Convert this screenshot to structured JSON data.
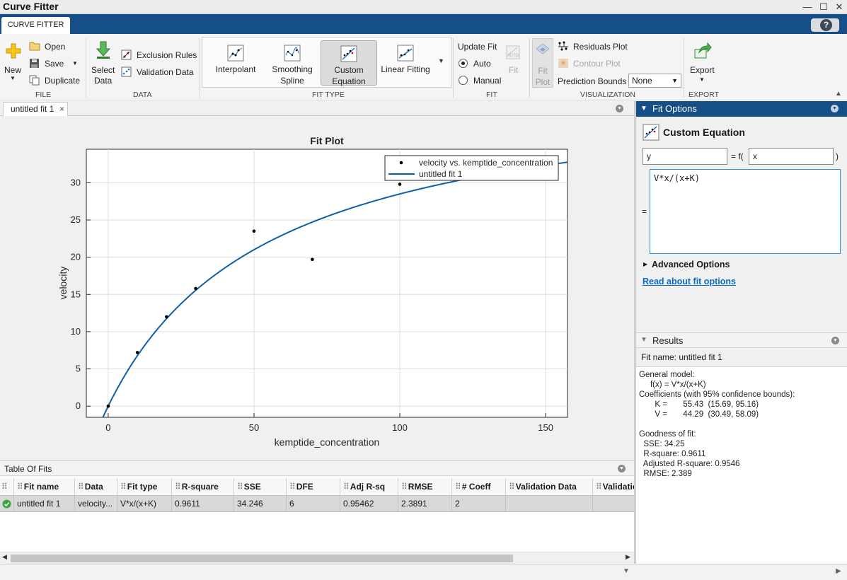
{
  "window": {
    "title": "Curve Fitter"
  },
  "ribbon": {
    "tab": "CURVE FITTER",
    "file": {
      "new": "New",
      "open": "Open",
      "save": "Save",
      "duplicate": "Duplicate",
      "section": "FILE"
    },
    "data": {
      "select_line1": "Select",
      "select_line2": "Data",
      "exclusion": "Exclusion Rules",
      "validation": "Validation Data",
      "section": "DATA"
    },
    "fit_type": {
      "interpolant": "Interpolant",
      "spline_line1": "Smoothing",
      "spline_line2": "Spline",
      "custom_line1": "Custom",
      "custom_line2": "Equation",
      "linear": "Linear Fitting",
      "section": "FIT TYPE"
    },
    "fit": {
      "update": "Update Fit",
      "auto": "Auto",
      "manual": "Manual",
      "auto_icon_text": "AUTO",
      "fit": "Fit",
      "section": "FIT"
    },
    "visualization": {
      "fit_plot_line1": "Fit",
      "fit_plot_line2": "Plot",
      "residuals": "Residuals Plot",
      "contour": "Contour Plot",
      "pred_bounds": "Prediction Bounds",
      "pred_value": "None",
      "section": "VISUALIZATION"
    },
    "export": {
      "label": "Export",
      "section": "EXPORT"
    }
  },
  "document": {
    "tab": "untitled fit 1"
  },
  "chart_data": {
    "type": "scatter",
    "title": "Fit Plot",
    "xlabel": "kemptide_concentration",
    "ylabel": "velocity",
    "xlim": [
      -7.5,
      157.5
    ],
    "ylim": [
      -1.5,
      34.5
    ],
    "xticks": [
      0,
      50,
      100,
      150
    ],
    "yticks": [
      0,
      5,
      10,
      15,
      20,
      25,
      30
    ],
    "grid": true,
    "legend_position": "top-right",
    "series": [
      {
        "name": "velocity vs. kemptide_concentration",
        "kind": "points",
        "color": "#000000",
        "x": [
          0,
          10,
          20,
          30,
          50,
          70,
          100
        ],
        "y": [
          0,
          7.2,
          12.0,
          15.8,
          23.5,
          19.7,
          29.8
        ]
      },
      {
        "name": "untitled fit 1",
        "kind": "line",
        "color": "#0f5fa8",
        "model": {
          "V": 44.29,
          "K": 55.43
        }
      }
    ]
  },
  "table_of_fits": {
    "title": "Table Of Fits",
    "columns": [
      "Fit name",
      "Data",
      "Fit type",
      "R-square",
      "SSE",
      "DFE",
      "Adj R-sq",
      "RMSE",
      "# Coeff",
      "Validation Data",
      "Validatio"
    ],
    "rows": [
      [
        "untitled fit 1",
        "velocity...",
        "V*x/(x+K)",
        "0.9611",
        "34.246",
        "6",
        "0.95462",
        "2.3891",
        "2",
        "",
        ""
      ]
    ]
  },
  "fit_options": {
    "header": "Fit Options",
    "title": "Custom Equation",
    "dep_var": "y",
    "func_open": "= f(",
    "indep_var": "x",
    "func_close": ")",
    "equals": "=",
    "equation": "V*x/(x+K)",
    "advanced": "Advanced Options",
    "link": "Read about fit options"
  },
  "results": {
    "header": "Results",
    "fit_name": "Fit name: untitled fit 1",
    "lines": [
      "General model:",
      "     f(x) = V*x/(x+K)",
      "Coefficients (with 95% confidence bounds):",
      "       K =       55.43  (15.69, 95.16)",
      "       V =       44.29  (30.49, 58.09)",
      "",
      "Goodness of fit:",
      "  SSE: 34.25",
      "  R-square: 0.9611",
      "  Adjusted R-square: 0.9546",
      "  RMSE: 2.389"
    ]
  },
  "colors": {
    "accent": "#164f88",
    "fit_line": "#0f5fa8",
    "ok": "#3ba53b"
  }
}
